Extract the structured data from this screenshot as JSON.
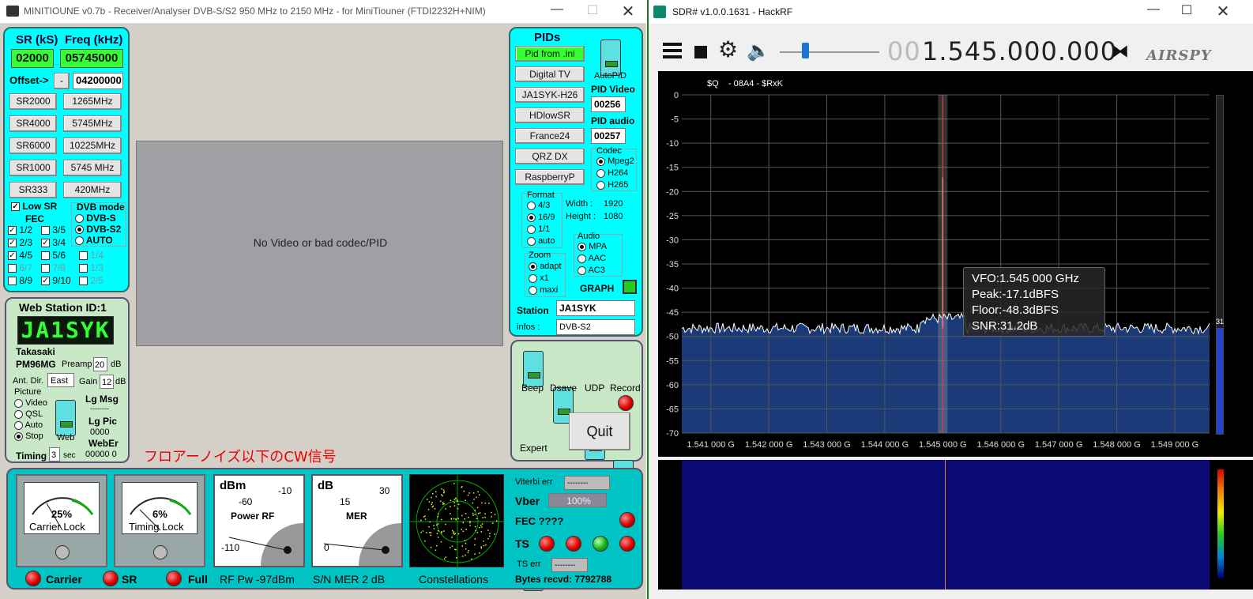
{
  "mt": {
    "title": "MINITIOUNE v0.7b - Receiver/Analyser DVB-S/S2 950 MHz to 2150 MHz - for MiniTiouner (FTDI2232H+NIM)",
    "sr_header": "SR (kS)",
    "freq_header": "Freq (kHz)",
    "sr_value": "02000",
    "freq_value": "05745000",
    "offset_label": "Offset->",
    "offset_sign": "-",
    "offset_value": "04200000",
    "sr_buttons": [
      "SR2000",
      "SR4000",
      "SR6000",
      "SR1000",
      "SR333"
    ],
    "freq_buttons": [
      "1265MHz",
      "5745MHz",
      "10225MHz",
      "5745 MHz",
      "420MHz"
    ],
    "low_sr": "Low SR",
    "fec": "FEC",
    "dvb_mode": "DVB mode",
    "dvb_s": "DVB-S",
    "dvb_s2": "DVB-S2",
    "auto": "AUTO",
    "fec_items": [
      "1/2",
      "3/5",
      "2/3",
      "3/4",
      "4/5",
      "5/6",
      "1/4",
      "6/7",
      "7/8",
      "1/3",
      "8/9",
      "9/10",
      "2/5"
    ],
    "video_msg": "No Video or bad codec/PID",
    "web_station": "Web Station ID:1",
    "callsign_lcd": "JA1SYK",
    "city": "Takasaki",
    "locator": "PM96MG",
    "preamp_label": "Preamp",
    "preamp_value": "20",
    "db": "dB",
    "ant_dir_label": "Ant. Dir.",
    "ant_dir_value": "East",
    "gain_label": "Gain",
    "gain_value": "12",
    "picture": "Picture",
    "pic_opts": [
      "Video",
      "QSL",
      "Auto",
      "Stop"
    ],
    "web": "Web",
    "lg_msg": "Lg Msg",
    "dashes": "--------",
    "lg_pic": "Lg Pic",
    "lg_pic_val": "0000",
    "weber": "WebEr",
    "weber_val": "00000  0",
    "timing_label": "Timing",
    "timing_value": "3",
    "sec": "sec",
    "note": "フロアーノイズ以下のCW信号",
    "pids": "PIDs",
    "pid_buttons": [
      "Pid from .ini",
      "Digital TV",
      "JA1SYK-H26",
      "HDlowSR",
      "France24",
      "QRZ DX",
      "RaspberryP"
    ],
    "autopid": "AutoPID",
    "pid_video": "PID Video",
    "pid_video_val": "00256",
    "pid_audio": "PID audio",
    "pid_audio_val": "00257",
    "codec": "Codec",
    "codecs": [
      "Mpeg2",
      "H264",
      "H265"
    ],
    "format": "Format",
    "formats": [
      "4/3",
      "16/9",
      "1/1",
      "auto"
    ],
    "width_label": "Width :",
    "width_val": "1920",
    "height_label": "Height :",
    "height_val": "1080",
    "audio": "Audio",
    "audios": [
      "MPA",
      "AAC",
      "AC3"
    ],
    "zoom": "Zoom",
    "zooms": [
      "adapt",
      "x1",
      "maxi"
    ],
    "graph": "GRAPH",
    "station_label": "Station",
    "station_val": "JA1SYK",
    "infos_label": "infos :",
    "infos_val": "DVB-S2",
    "sw_labels": [
      "Beep",
      "Dsave",
      "UDP",
      "Record",
      "Expert"
    ],
    "quit": "Quit",
    "carrier_pct": "25%",
    "carrier_lock": "Carrier Lock",
    "timing_pct": "6%",
    "timing_lock": "Timing Lock",
    "power_unit": "dBm",
    "power_ticks": [
      "-60",
      "-10",
      "-110"
    ],
    "power_rf": "Power RF",
    "mer_unit": "dB",
    "mer_ticks": [
      "15",
      "30",
      "0"
    ],
    "mer": "MER",
    "viterbi": "Viterbi err",
    "viterbi_val": "--------",
    "vber": "Vber",
    "vber_val": "100%",
    "fec_q": "FEC ????",
    "ts": "TS",
    "ts_err": "TS err",
    "ts_err_val": "--------",
    "bytes": "Bytes recvd:  7792788",
    "bottom": [
      "Carrier",
      "SR",
      "Full",
      "RF Pw -97dBm",
      "S/N MER  2 dB",
      "Constellations"
    ]
  },
  "sdr": {
    "title": "SDR# v1.0.0.1631 - HackRF",
    "freq_dim": "00",
    "freq_main": "1.545.000.000",
    "brand": "AIRSPY",
    "header_text": "$Q    - 08A4 - $RxK",
    "side_val": "31",
    "tooltip": [
      "VFO:1.545 000 GHz",
      "Peak:-17.1dBFS",
      "Floor:-48.3dBFS",
      "SNR:31.2dB"
    ]
  },
  "chart_data": {
    "type": "line",
    "title": "",
    "xlabel": "",
    "ylabel": "",
    "x_unit": "GHz",
    "x_ticks": [
      "1.541 000 G",
      "1.542 000 G",
      "1.543 000 G",
      "1.544 000 G",
      "1.545 000 G",
      "1.546 000 G",
      "1.547 000 G",
      "1.548 000 G",
      "1.549 000 G"
    ],
    "y_ticks": [
      "0",
      "-5",
      "-10",
      "-15",
      "-20",
      "-25",
      "-30",
      "-35",
      "-40",
      "-45",
      "-50",
      "-55",
      "-60",
      "-65",
      "-70"
    ],
    "ylim": [
      -70,
      0
    ],
    "xlim": [
      1.5405,
      1.5496
    ],
    "noise_floor_db": -48.3,
    "peak": {
      "x": 1.545,
      "y": -17.1
    },
    "grid": true,
    "colors": {
      "trace": "#ffffff",
      "fill": "#1b3a78",
      "vfo": "#ff3030"
    }
  }
}
